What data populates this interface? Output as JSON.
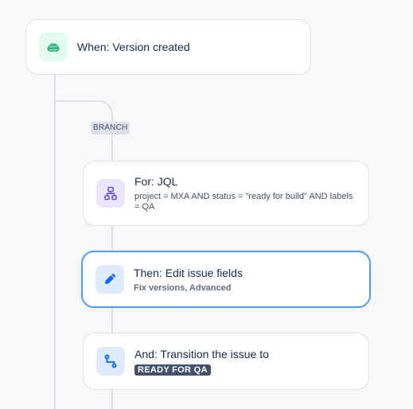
{
  "workflow": {
    "trigger": {
      "title": "When: Version created",
      "icon": "ship-icon",
      "color": "#36b37e"
    },
    "branch": {
      "label": "BRANCH",
      "card": {
        "title": "For: JQL",
        "query": "project = MXA AND status = \"ready for build\" AND labels = QA",
        "icon": "hierarchy-icon",
        "color": "#6554c0"
      }
    },
    "actions": [
      {
        "title": "Then: Edit issue fields",
        "details": "Fix versions, Advanced",
        "icon": "pencil-icon",
        "color": "#0065ff",
        "selected": true
      },
      {
        "title": "And: Transition the issue to",
        "status": "READY FOR QA",
        "icon": "transition-icon",
        "color": "#0065ff"
      }
    ]
  }
}
